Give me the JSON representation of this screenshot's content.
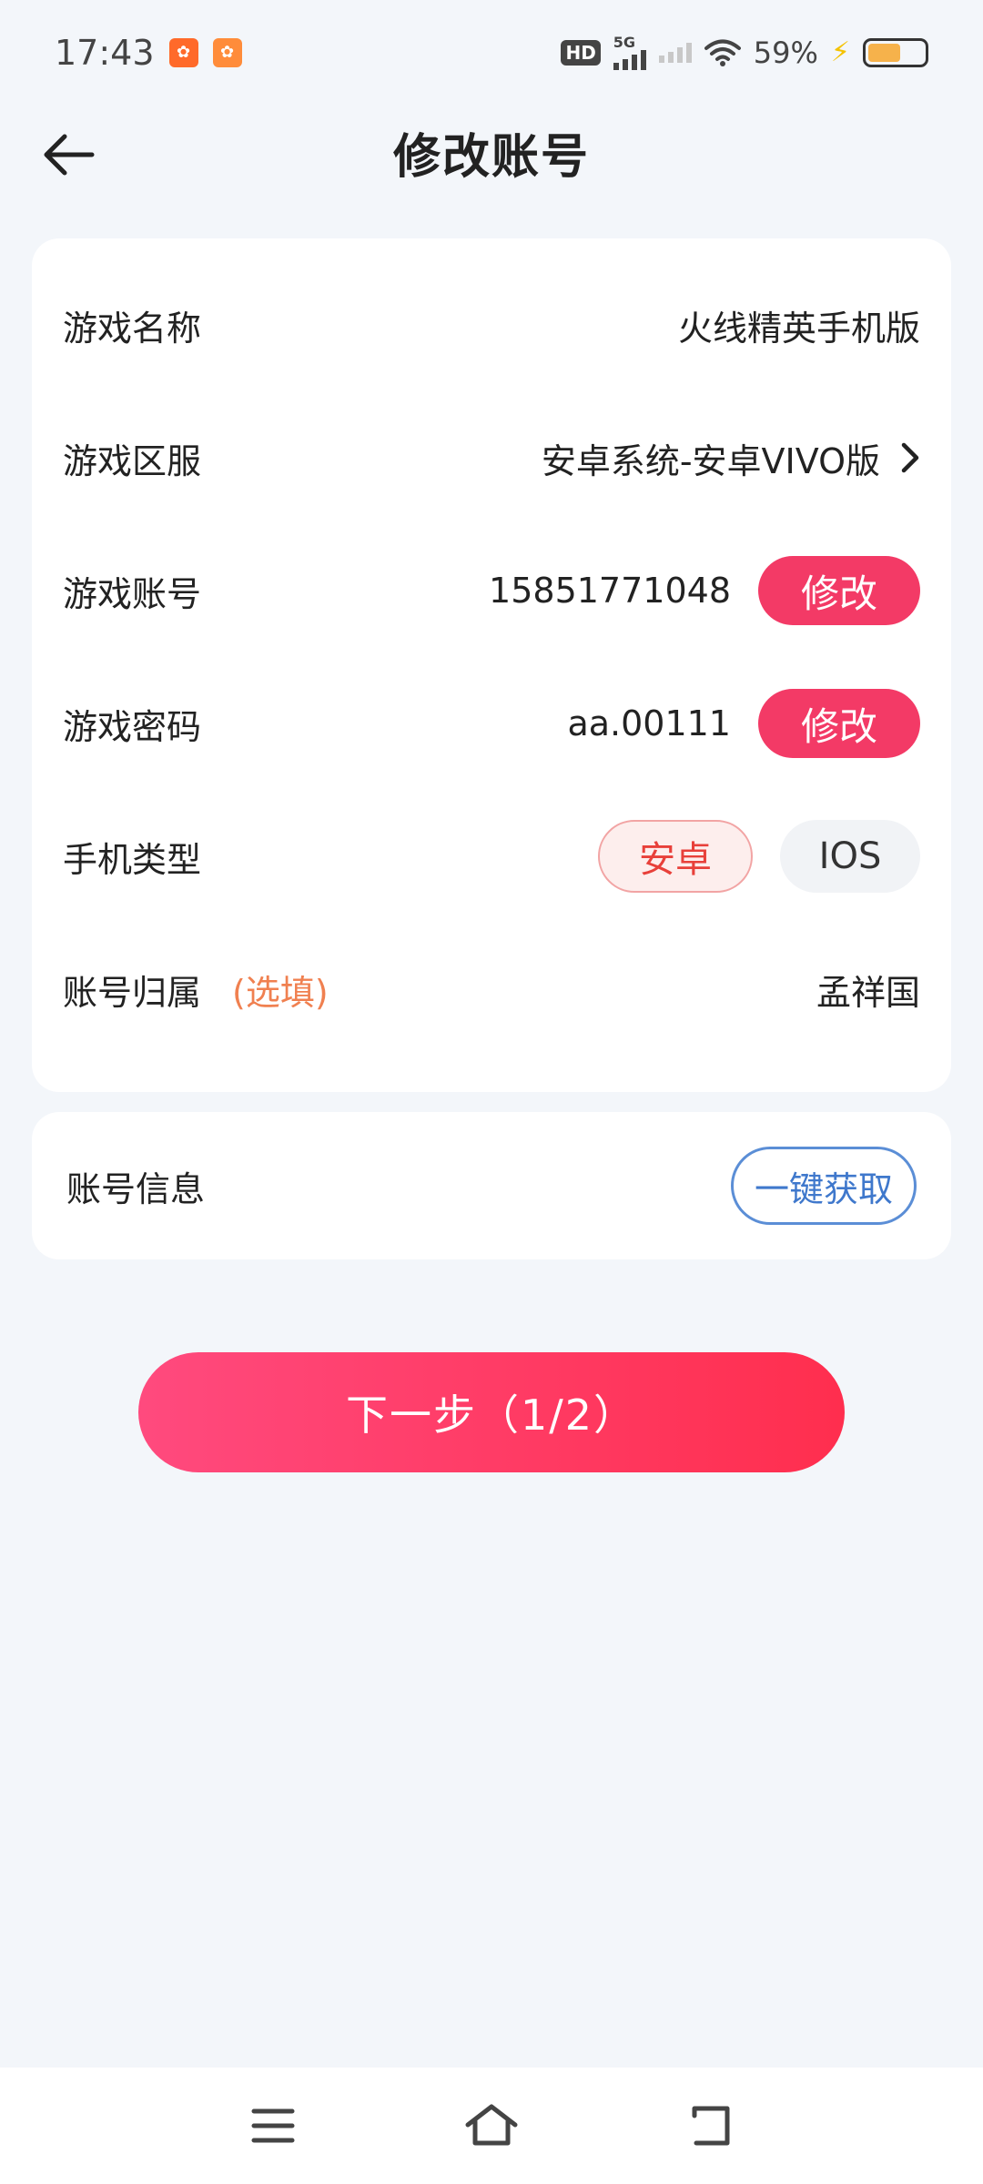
{
  "status_bar": {
    "time": "17:43",
    "network_hd": "HD",
    "network_5g": "5G",
    "battery_percent": "59%",
    "battery_level": 0.59,
    "icons": [
      "app-badge-icon",
      "app-badge-icon",
      "hd-icon",
      "signal-5g-icon",
      "signal-icon",
      "wifi-icon",
      "charging-bolt-icon",
      "battery-icon"
    ]
  },
  "header": {
    "title": "修改账号",
    "back_icon": "arrow-left-icon"
  },
  "account_form": {
    "game_name": {
      "label": "游戏名称",
      "value": "火线精英手机版"
    },
    "game_server": {
      "label": "游戏区服",
      "value": "安卓系统-安卓VIVO版",
      "icon": "chevron-right-icon"
    },
    "game_account": {
      "label": "游戏账号",
      "value": "15851771048",
      "button": "修改"
    },
    "game_password": {
      "label": "游戏密码",
      "value": "aa.00111",
      "button": "修改"
    },
    "phone_type": {
      "label": "手机类型",
      "options": [
        "安卓",
        "IOS"
      ],
      "selected": "安卓"
    },
    "owner": {
      "label": "账号归属",
      "optional": "(选填)",
      "value": "孟祥国"
    }
  },
  "account_info": {
    "label": "账号信息",
    "button": "一键获取"
  },
  "next_button": "下一步（1/2）",
  "colors": {
    "accent": "#f33a66",
    "background": "#f3f6fa",
    "blue_outline": "#5b8ed6",
    "optional_text": "#f08050"
  },
  "nav_bar": {
    "icons": [
      "menu-icon",
      "home-icon",
      "back-icon"
    ]
  }
}
